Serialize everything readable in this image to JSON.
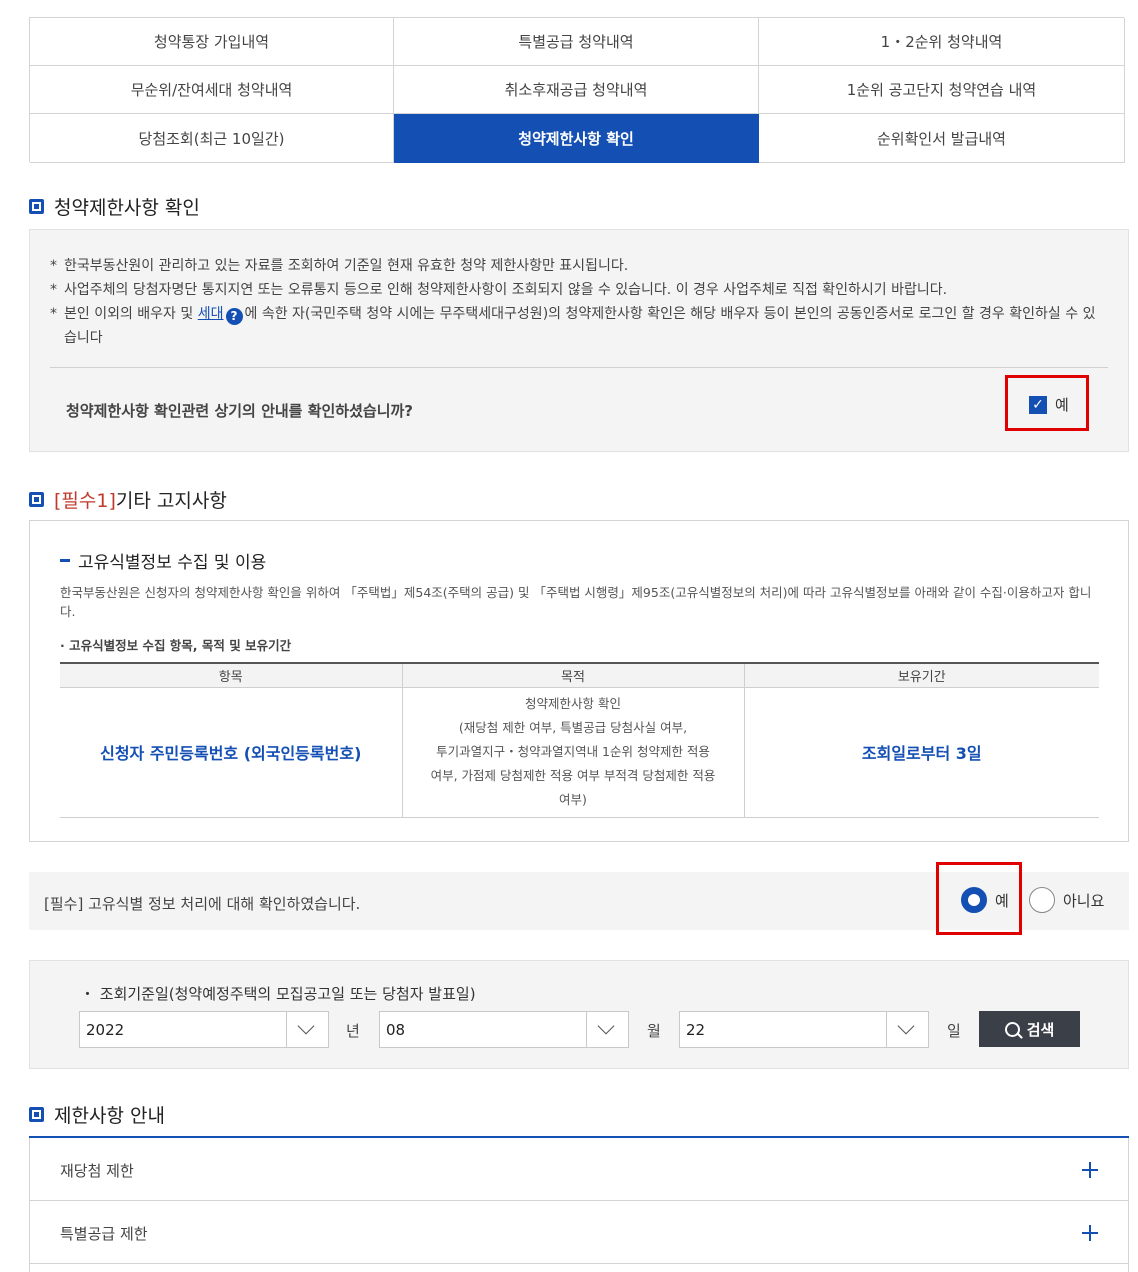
{
  "tabs": [
    {
      "label": "청약통장 가입내역"
    },
    {
      "label": "특별공급 청약내역"
    },
    {
      "label": "1・2순위 청약내역"
    },
    {
      "label": "무순위/잔여세대 청약내역"
    },
    {
      "label": "취소후재공급 청약내역"
    },
    {
      "label": "1순위 공고단지 청약연습 내역"
    },
    {
      "label": "당첨조회(최근 10일간)"
    },
    {
      "label": "청약제한사항 확인"
    },
    {
      "label": "순위확인서 발급내역"
    }
  ],
  "section1": {
    "title": "청약제한사항 확인",
    "notes": [
      "한국부동산원이 관리하고 있는 자료를 조회하여 기준일 현재 유효한 청약 제한사항만 표시됩니다.",
      "사업주체의 당첨자명단 통지지연 또는 오류통지 등으로 인해 청약제한사항이 조회되지 않을 수 있습니다. 이 경우 사업주체로 직접 확인하시기 바랍니다."
    ],
    "note3_before": "본인 이외의 배우자 및 ",
    "note3_link": "세대",
    "note3_help_icon": "?",
    "note3_after": "에 속한 자(국민주택 청약 시에는 무주택세대구성원)의 청약제한사항 확인은 해당 배우자 등이 본인의 공동인증서로 로그인 할 경우 확인하실 수 있습니다",
    "note_mark": "*",
    "confirm_question": "청약제한사항 확인관련 상기의 안내를 확인하셨습니까?",
    "confirm_label": "예",
    "check_mark": "✓"
  },
  "section2": {
    "title_prefix": "[필수1]",
    "title_rest": " 기타 고지사항",
    "sub_title": "고유식별정보 수집 및 이용",
    "description": "한국부동산원은 신청자의 청약제한사항 확인을 위하여 「주택법」제54조(주택의 공급) 및 「주택법 시행령」제95조(고유식별정보의 처리)에 따라 고유식별정보를 아래와 같이 수집·이용하고자 합니다.",
    "bullet_title": "· 고유식별정보 수집 항목, 목적 및 보유기간",
    "table": {
      "headers": [
        "항목",
        "목적",
        "보유기간"
      ],
      "item": "신청자 주민등록번호 (외국인등록번호)",
      "purpose_lines": [
        "청약제한사항 확인",
        "(재당첨 제한 여부, 특별공급 당첨사실 여부,",
        "투기과열지구・청약과열지역내 1순위 청약제한 적용",
        "여부, 가점제 당첨제한 적용 여부 부적격 당첨제한 적용",
        "여부)"
      ],
      "retention": "조회일로부터 3일"
    },
    "required_text": "[필수] 고유식별 정보 처리에 대해 확인하였습니다.",
    "radio_yes": "예",
    "radio_no": "아니요",
    "selected": "yes"
  },
  "search": {
    "label": "・ 조회기준일(청약예정주택의 모집공고일 또는 당첨자 발표일)",
    "year": "2022",
    "year_unit": "년",
    "month": "08",
    "month_unit": "월",
    "day": "22",
    "day_unit": "일",
    "button": "검색"
  },
  "section3": {
    "title": "제한사항 안내",
    "items": [
      {
        "label": "재당첨 제한"
      },
      {
        "label": "특별공급 제한"
      }
    ]
  },
  "colors": {
    "accent": "#1450b4",
    "highlight": "#e00000",
    "button_dark": "#3b3f48"
  }
}
